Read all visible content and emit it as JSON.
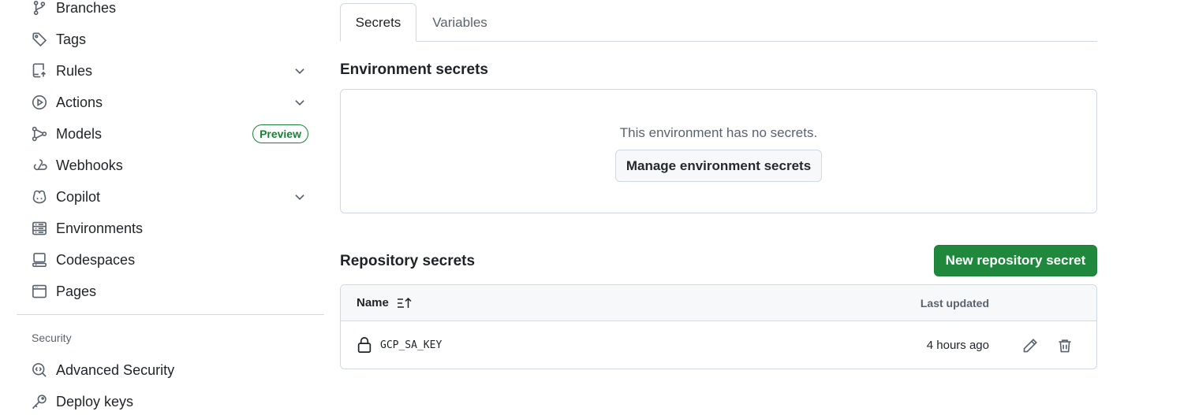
{
  "sidebar": {
    "items": [
      {
        "label": "Branches",
        "icon": "git-branch-icon"
      },
      {
        "label": "Tags",
        "icon": "tag-icon"
      },
      {
        "label": "Rules",
        "icon": "repo-push-icon",
        "expandable": true
      },
      {
        "label": "Actions",
        "icon": "play-icon",
        "expandable": true
      },
      {
        "label": "Models",
        "icon": "ai-model-icon",
        "badge": "Preview"
      },
      {
        "label": "Webhooks",
        "icon": "webhook-icon"
      },
      {
        "label": "Copilot",
        "icon": "copilot-icon",
        "expandable": true
      },
      {
        "label": "Environments",
        "icon": "server-icon"
      },
      {
        "label": "Codespaces",
        "icon": "codespaces-icon"
      },
      {
        "label": "Pages",
        "icon": "browser-icon"
      }
    ],
    "security_heading": "Security",
    "security_items": [
      {
        "label": "Advanced Security",
        "icon": "codescan-icon"
      },
      {
        "label": "Deploy keys",
        "icon": "key-icon"
      }
    ]
  },
  "tabs": [
    {
      "label": "Secrets",
      "active": true
    },
    {
      "label": "Variables",
      "active": false
    }
  ],
  "environment": {
    "title": "Environment secrets",
    "empty_message": "This environment has no secrets.",
    "manage_button": "Manage environment secrets"
  },
  "repository": {
    "title": "Repository secrets",
    "new_button": "New repository secret",
    "columns": {
      "name": "Name",
      "updated": "Last updated"
    },
    "rows": [
      {
        "name": "GCP_SA_KEY",
        "updated": "4 hours ago"
      }
    ]
  },
  "colors": {
    "primary_button": "#1f883d",
    "preview_badge": "#1a7f37",
    "border": "#d1d9e0",
    "muted_text": "#59636e"
  }
}
